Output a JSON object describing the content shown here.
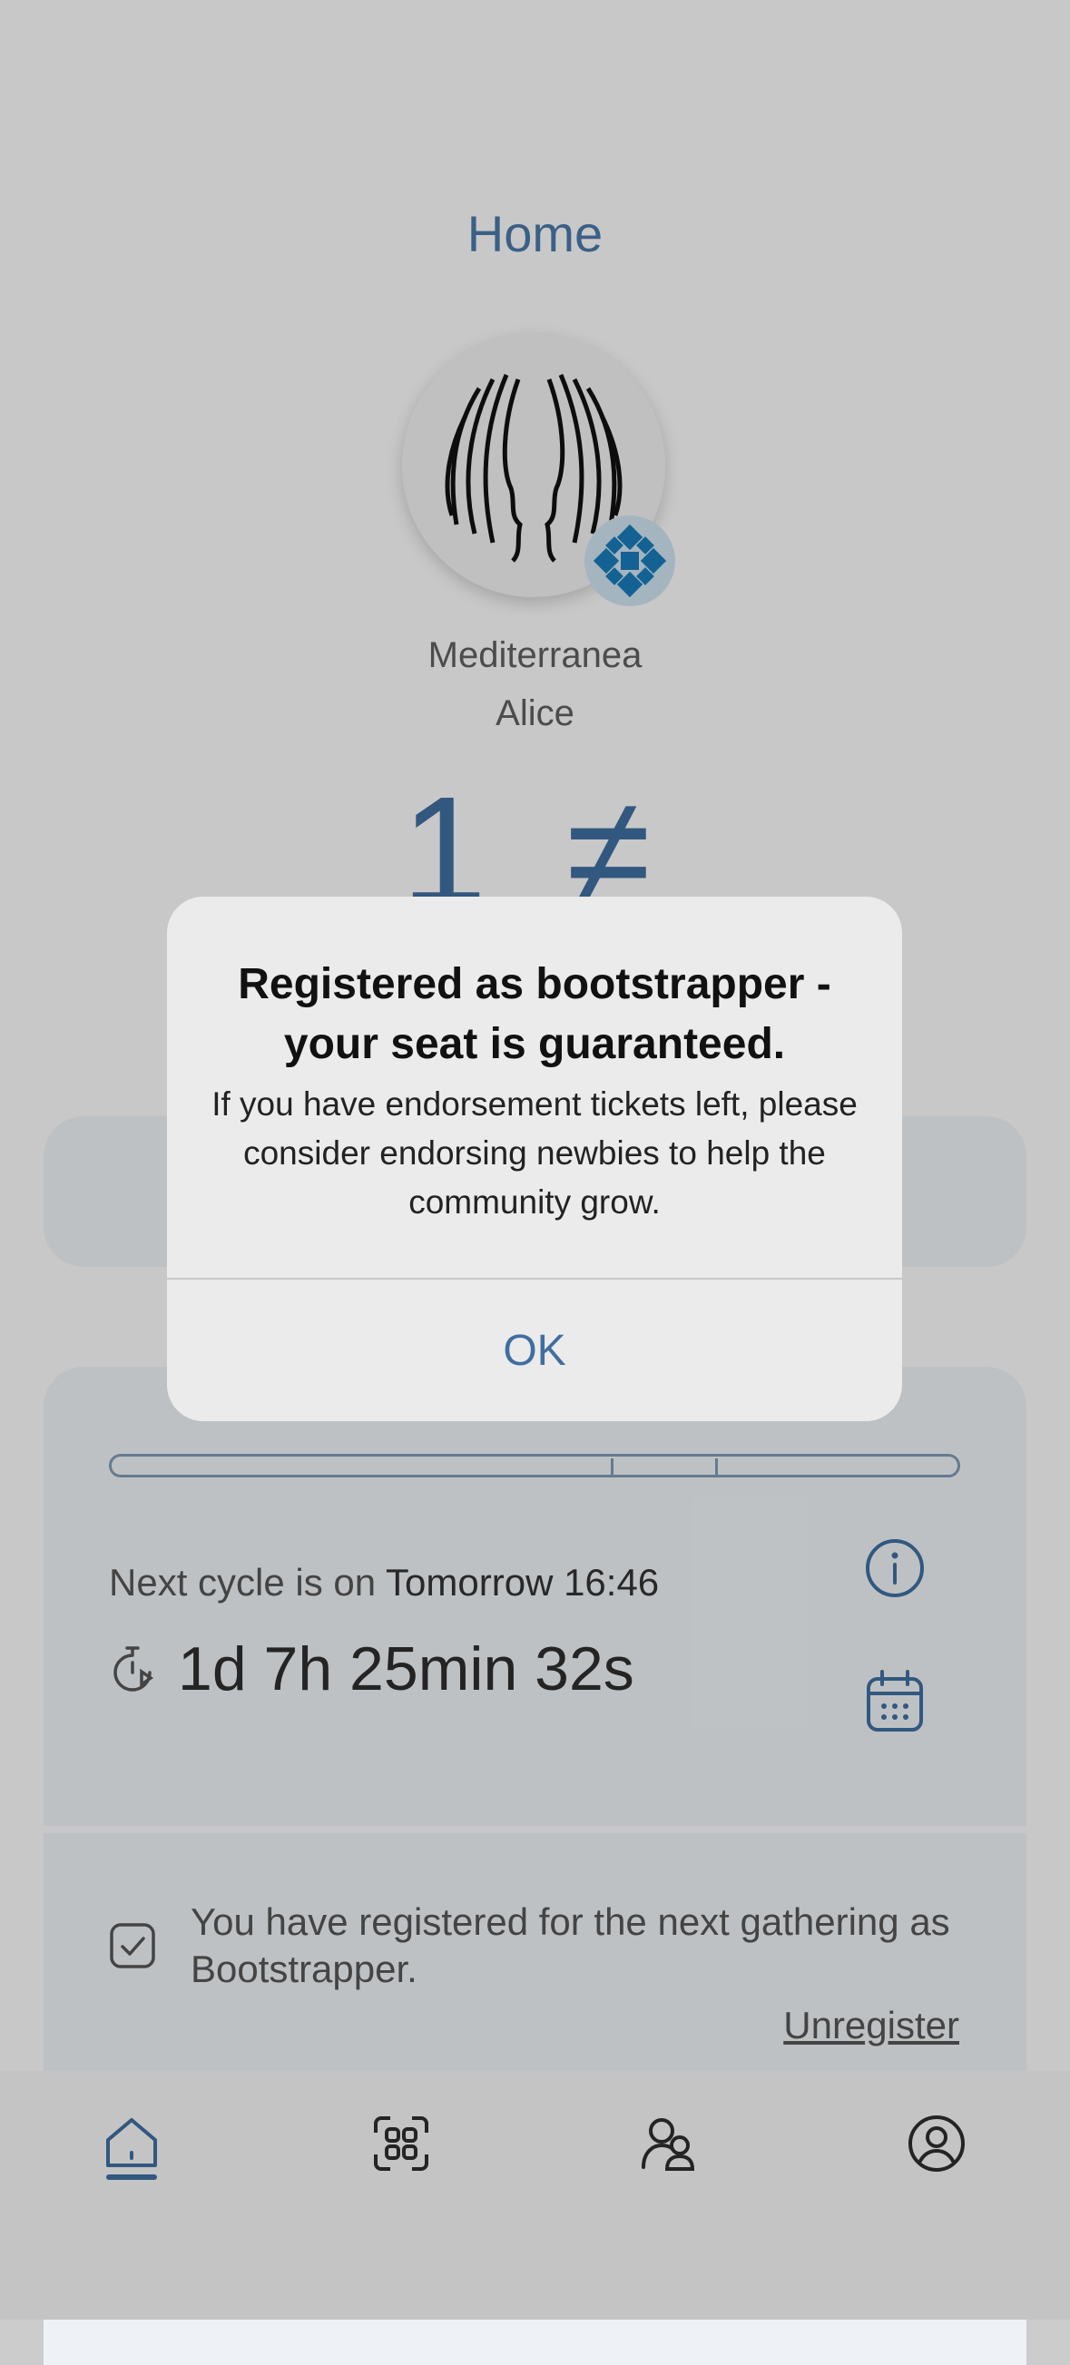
{
  "header": {
    "title": "Home"
  },
  "community": {
    "name": "Mediterranea",
    "user": "Alice"
  },
  "balance": {
    "amount": "1",
    "currency_symbol": "≠"
  },
  "cycle": {
    "next_prefix": "Next cycle is on",
    "next_date": "Tomorrow 16:46",
    "countdown": "1d 7h 25min 32s"
  },
  "registration": {
    "message": "You have registered for the next gathering as Bootstrapper.",
    "unregister_label": "Unregister"
  },
  "dialog": {
    "title": "Registered as bootstrapper - your seat is guaranteed.",
    "message": "If you have endorsement tickets left, please consider endorsing newbies to help the community grow.",
    "ok_label": "OK"
  },
  "tabbar": {
    "items": [
      {
        "icon": "home-icon",
        "active": true
      },
      {
        "icon": "apps-icon",
        "active": false
      },
      {
        "icon": "contacts-icon",
        "active": false
      },
      {
        "icon": "profile-icon",
        "active": false
      }
    ]
  },
  "colors": {
    "accent": "#3f6ea0",
    "background": "#fafafa",
    "card": "#eef2f6"
  }
}
